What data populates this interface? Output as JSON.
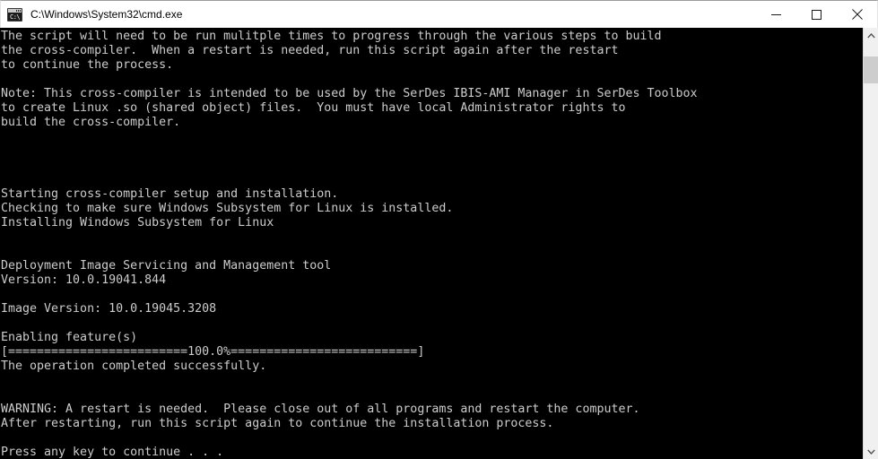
{
  "window": {
    "title": "C:\\Windows\\System32\\cmd.exe",
    "icon_name": "cmd-exe-icon",
    "icon_prompt_text": "C:\\",
    "background_color": "#000000",
    "titlebar_color": "#ffffff",
    "text_color": "#cccccc",
    "controls": {
      "minimize_label": "Minimize",
      "maximize_label": "Maximize",
      "close_label": "Close"
    }
  },
  "scrollbar": {
    "up_arrow_label": "Scroll up",
    "down_arrow_label": "Scroll down",
    "thumb_label": "Scroll thumb"
  },
  "console": {
    "lines": [
      "The script will need to be run mulitple times to progress through the various steps to build",
      "the cross-compiler.  When a restart is needed, run this script again after the restart",
      "to continue the process.",
      "",
      "Note: This cross-compiler is intended to be used by the SerDes IBIS-AMI Manager in SerDes Toolbox",
      "to create Linux .so (shared object) files.  You must have local Administrator rights to",
      "build the cross-compiler.",
      "",
      "",
      "",
      "",
      "Starting cross-compiler setup and installation.",
      "Checking to make sure Windows Subsystem for Linux is installed.",
      "Installing Windows Subsystem for Linux",
      "",
      "",
      "Deployment Image Servicing and Management tool",
      "Version: 10.0.19041.844",
      "",
      "Image Version: 10.0.19045.3208",
      "",
      "Enabling feature(s)",
      "[=========================100.0%==========================]",
      "The operation completed successfully.",
      "",
      "",
      "WARNING: A restart is needed.  Please close out of all programs and restart the computer.",
      "After restarting, run this script again to continue the installation process.",
      "",
      "Press any key to continue . . ."
    ],
    "progress_percent": "100.0%",
    "dism_version": "10.0.19041.844",
    "image_version": "10.0.19045.3208"
  }
}
